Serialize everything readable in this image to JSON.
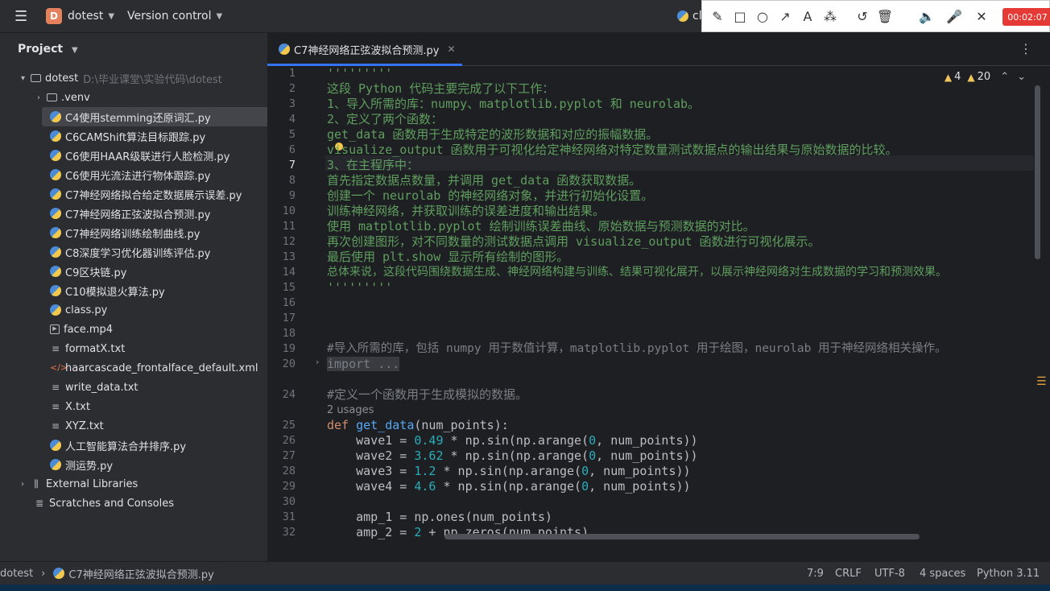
{
  "titlebar": {
    "menu_icon": "hamburger-icon",
    "project_badge": "D",
    "project_name": "dotest",
    "vcs_label": "Version control",
    "run_config_partial": "cl"
  },
  "recorder": {
    "tools": [
      "pencil-icon",
      "rectangle-icon",
      "circle-icon",
      "arrow-icon",
      "text-icon",
      "magic-wand-icon",
      "undo-icon",
      "trash-icon",
      "speaker-icon",
      "microphone-icon",
      "close-icon"
    ],
    "timer": "00:02:07"
  },
  "project_panel": {
    "title": "Project",
    "root": {
      "name": "dotest",
      "path": "D:\\毕业课堂\\实验代码\\dotest"
    },
    "items": [
      {
        "label": ".venv",
        "type": "folder"
      },
      {
        "label": "C4使用stemming还原词汇.py",
        "type": "py",
        "selected": true
      },
      {
        "label": "C6CAMShift算法目标跟踪.py",
        "type": "py"
      },
      {
        "label": "C6使用HAAR级联进行人脸检测.py",
        "type": "py"
      },
      {
        "label": "C6使用光流法进行物体跟踪.py",
        "type": "py"
      },
      {
        "label": "C7神经网络拟合给定数据展示误差.py",
        "type": "py"
      },
      {
        "label": "C7神经网络正弦波拟合预测.py",
        "type": "py"
      },
      {
        "label": "C7神经网络训练绘制曲线.py",
        "type": "py"
      },
      {
        "label": "C8深度学习优化器训练评估.py",
        "type": "py"
      },
      {
        "label": "C9区块链.py",
        "type": "py"
      },
      {
        "label": "C10模拟退火算法.py",
        "type": "py"
      },
      {
        "label": "class.py",
        "type": "py"
      },
      {
        "label": "face.mp4",
        "type": "mp4"
      },
      {
        "label": "formatX.txt",
        "type": "txt"
      },
      {
        "label": "haarcascade_frontalface_default.xml",
        "type": "xml"
      },
      {
        "label": "write_data.txt",
        "type": "txt"
      },
      {
        "label": "X.txt",
        "type": "txt"
      },
      {
        "label": "XYZ.txt",
        "type": "txt"
      },
      {
        "label": "人工智能算法合并排序.py",
        "type": "py"
      },
      {
        "label": "测运势.py",
        "type": "py"
      }
    ],
    "external_libraries": "External Libraries",
    "scratches": "Scratches and Consoles"
  },
  "editor": {
    "tab_label": "C7神经网络正弦波拟合预测.py",
    "warnings": "4",
    "weak_warnings": "20",
    "line_numbers": [
      "1",
      "2",
      "3",
      "4",
      "5",
      "6",
      "7",
      "8",
      "9",
      "10",
      "11",
      "12",
      "13",
      "14",
      "15",
      "16",
      "17",
      "18",
      "19",
      "20",
      "",
      "24",
      "",
      "25",
      "26",
      "27",
      "28",
      "29",
      "30",
      "31",
      "32"
    ],
    "lines": {
      "l1": "'''''''''",
      "l2": "这段 Python 代码主要完成了以下工作：",
      "l3": "1、导入所需的库：numpy、matplotlib.pyplot 和 neurolab。",
      "l4": "2、定义了两个函数：",
      "l5": "get_data 函数用于生成特定的波形数据和对应的振幅数据。",
      "l6": "visualize_output 函数用于可视化给定神经网络对特定数量测试数据点的输出结果与原始数据的比较。",
      "l7": "3、在主程序中：",
      "l8": "首先指定数据点数量，并调用 get_data 函数获取数据。",
      "l9": "创建一个 neurolab 的神经网络对象，并进行初始化设置。",
      "l10": "训练神经网络，并获取训练的误差进度和输出结果。",
      "l11": "使用 matplotlib.pyplot 绘制训练误差曲线、原始数据与预测数据的对比。",
      "l12": "再次创建图形，对不同数量的测试数据点调用 visualize_output 函数进行可视化展示。",
      "l13": "最后使用 plt.show 显示所有绘制的图形。",
      "l14": "总体来说，这段代码围绕数据生成、神经网络构建与训练、结果可视化展开，以展示神经网络对生成数据的学习和预测效果。",
      "l15": "'''''''''",
      "l19": "#导入所需的库，包括 numpy 用于数值计算，matplotlib.pyplot 用于绘图，neurolab 用于神经网络相关操作。",
      "l20_kw": "import",
      "l20_fold": " ...",
      "l24": "#定义一个函数用于生成模拟的数据。",
      "usages": "2 usages",
      "l25_def": "def",
      "l25_fn": "get_data",
      "l25_rest": "(num_points):",
      "l26_a": "    wave1 = ",
      "l26_n": "0.49",
      "l26_b": " * np.sin(np.arange(",
      "l26_z": "0",
      "l26_c": ", num_points))",
      "l27_a": "    wave2 = ",
      "l27_n": "3.62",
      "l28_a": "    wave3 = ",
      "l28_n": "1.2",
      "l29_a": "    wave4 = ",
      "l29_n": "4.6",
      "l31": "    amp_1 = np.ones(num_points)",
      "l32_a": "    amp_2 = ",
      "l32_n": "2",
      "l32_b": " + np.zeros(num_points)"
    }
  },
  "statusbar": {
    "breadcrumb_project": "dotest",
    "breadcrumb_file": "C7神经网络正弦波拟合预测.py",
    "position": "7:9",
    "line_sep": "CRLF",
    "encoding": "UTF-8",
    "indent": "4 spaces",
    "interpreter": "Python 3.11"
  }
}
